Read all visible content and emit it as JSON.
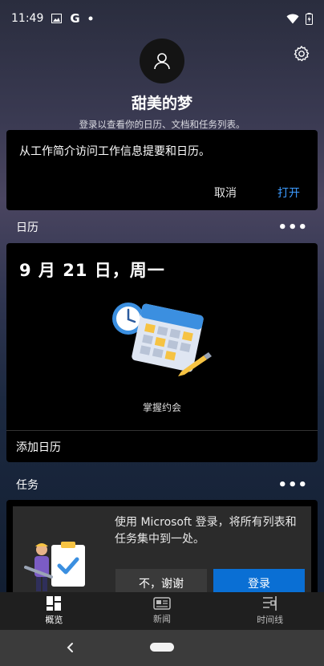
{
  "status": {
    "time": "11:49",
    "icons": [
      "image-icon",
      "google-icon",
      "dot-icon",
      "wifi-icon",
      "battery-icon"
    ]
  },
  "profile": {
    "name": "甜美的梦",
    "subtitle": "登录以查看你的日历、文档和任务列表。"
  },
  "work_card": {
    "text": "从工作简介访问工作信息提要和日历。",
    "cancel_label": "取消",
    "open_label": "打开"
  },
  "calendar": {
    "section_title": "日历",
    "more": "•••",
    "date": "9 月 21 日，周一",
    "caption": "掌握约会",
    "add_label": "添加日历"
  },
  "tasks": {
    "section_title": "任务",
    "more": "•••",
    "prompt": "使用 Microsoft 登录，将所有列表和任务集中到一处。",
    "no_label": "不，谢谢",
    "login_label": "登录"
  },
  "nav": {
    "items": [
      {
        "label": "概览",
        "icon": "overview-icon"
      },
      {
        "label": "新闻",
        "icon": "news-icon"
      },
      {
        "label": "时间线",
        "icon": "timeline-icon"
      }
    ]
  },
  "colors": {
    "accent": "#3d9bff",
    "primary_button": "#0a6fd4",
    "card": "#000000"
  }
}
